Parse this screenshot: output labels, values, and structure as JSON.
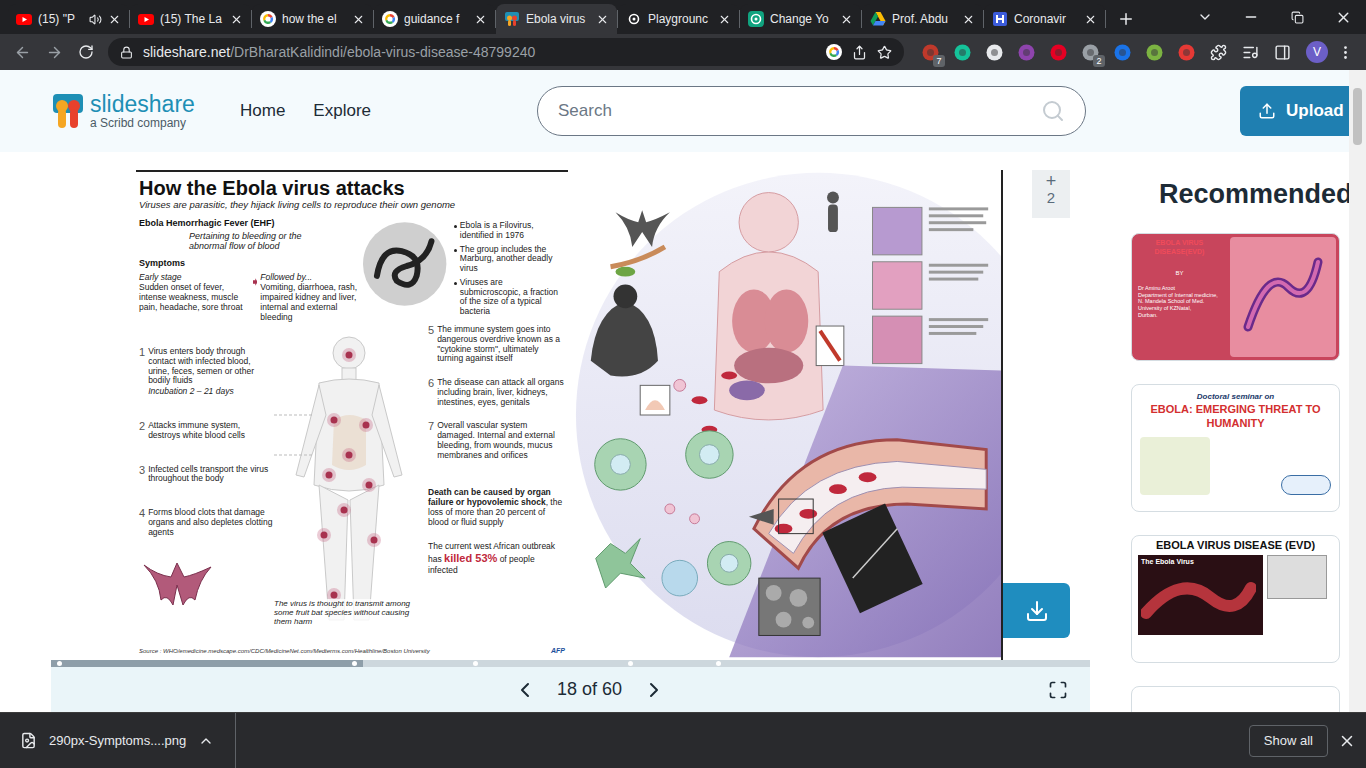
{
  "browser": {
    "tabs": [
      {
        "label": "(15) \"P",
        "kind": "youtube",
        "audio": true,
        "selected": false
      },
      {
        "label": "(15) The La",
        "kind": "youtube",
        "audio": false,
        "selected": false
      },
      {
        "label": "how the el",
        "kind": "google",
        "audio": false,
        "selected": false
      },
      {
        "label": "guidance f",
        "kind": "google",
        "audio": false,
        "selected": false
      },
      {
        "label": "Ebola virus",
        "kind": "slideshare",
        "audio": false,
        "selected": true
      },
      {
        "label": "Playgrounc",
        "kind": "openai-dark",
        "audio": false,
        "selected": false
      },
      {
        "label": "Change Yo",
        "kind": "openai",
        "audio": false,
        "selected": false
      },
      {
        "label": "Prof. Abdu",
        "kind": "drive",
        "audio": false,
        "selected": false
      },
      {
        "label": "Coronavir",
        "kind": "doc",
        "audio": false,
        "selected": false
      }
    ],
    "address": {
      "host": "slideshare.net",
      "path": "/DrBharatKalidindi/ebola-virus-disease-48799240"
    },
    "extensions": [
      {
        "kind": "dot",
        "color": "#c0392b",
        "badge": "7"
      },
      {
        "kind": "dot",
        "color": "#15c39a"
      },
      {
        "kind": "dot",
        "color": "#e8eaed"
      },
      {
        "kind": "dot",
        "color": "#8e44ad"
      },
      {
        "kind": "dot",
        "color": "#e60023"
      },
      {
        "kind": "dot",
        "color": "#9aa0a6",
        "badge": "2"
      },
      {
        "kind": "dot",
        "color": "#1a73e8"
      },
      {
        "kind": "dot",
        "color": "#7cb342"
      },
      {
        "kind": "dot",
        "color": "#e53935"
      },
      {
        "kind": "puzzle"
      },
      {
        "kind": "media"
      },
      {
        "kind": "panel"
      }
    ],
    "profile": "V"
  },
  "header": {
    "logo": {
      "name": "slideshare",
      "tagline": "a Scribd company"
    },
    "nav": [
      "Home",
      "Explore"
    ],
    "search": {
      "placeholder": "Search"
    },
    "upload": "Upload"
  },
  "slide": {
    "title": "How the Ebola virus attacks",
    "subtitle": "Viruses are parasitic, they hijack living cells to reproduce their own genome",
    "disease": "Ebola Hemorrhagic Fever (EHF)",
    "definition": "Pertaining to bleeding or the abnormal flow of blood",
    "symptoms_heading": "Symptoms",
    "symptoms": [
      {
        "label": "Early stage",
        "text": "Sudden onset of fever, intense weakness, muscle pain, headache, sore throat"
      },
      {
        "label": "Followed by...",
        "text": "Vomiting, diarrhoea, rash, impaired kidney and liver, internal and external bleeding"
      }
    ],
    "facts": [
      "Ebola is a Filovirus, identified in 1976",
      "The group includes the Marburg, another deadly virus",
      "Viruses are submicroscopic, a fraction of the size of a typical bacteria"
    ],
    "steps": [
      {
        "number": "1",
        "text": "Virus enters body through contact with infected blood, urine, feces, semen or other bodily fluids",
        "note": "Incubation 2 – 21 days",
        "side": "left"
      },
      {
        "number": "2",
        "text": "Attacks immune system, destroys white blood cells",
        "side": "left"
      },
      {
        "number": "3",
        "text": "Infected cells transport the virus throughout the body",
        "side": "left"
      },
      {
        "number": "4",
        "text": "Forms blood clots that damage organs and also depletes clotting agents",
        "side": "left"
      },
      {
        "number": "5",
        "text": "The immune system goes into dangerous overdrive known as a \"cytokine storm\", ultimately turning against itself",
        "side": "right"
      },
      {
        "number": "6",
        "text": "The disease can attack all organs including brain, liver, kidneys, intestines, eyes, genitals",
        "side": "right"
      },
      {
        "number": "7",
        "text": "Overall vascular system damaged. Internal and external bleeding, from wounds, mucus membranes and orifices",
        "side": "right"
      }
    ],
    "bat_note": "The virus is thought to transmit among some fruit bat species without causing them harm",
    "death": {
      "bold": "Death can be caused by organ failure or hypovolemic shock",
      "rest": ", the loss of more than 20 percent of blood or fluid supply"
    },
    "outbreak": {
      "before": "The current west African outbreak has ",
      "highlight": "killed 53%",
      "after": " of people infected"
    },
    "source": "Source : WHO/emedicine.medscape.com/CDC/MedicineNet.com/Medterms.com/Healthline/Boston University",
    "credit": "AFP"
  },
  "viewer": {
    "bookmark": {
      "plus": "+",
      "count": "2"
    },
    "page": "18 of 60",
    "progress": {
      "level": 0.3,
      "markers": [
        0.006,
        0.29,
        0.406,
        0.555,
        0.64
      ]
    }
  },
  "sidebar": {
    "title": "Recommended",
    "cards": [
      {
        "kind": "red",
        "title": "EBOLA VIRUS DISEASE(EVD)",
        "by": "BY",
        "author": [
          "Dr Aminu Aroot",
          "Department of Internal medicine,",
          "N. Mandela School of Med.",
          "University of KZNatal,",
          "Durban."
        ]
      },
      {
        "kind": "seminar",
        "kicker": "Doctoral seminar on",
        "title": "EBOLA: EMERGING THREAT TO HUMANITY"
      },
      {
        "kind": "dark",
        "title": "EBOLA VIRUS DISEASE (EVD)",
        "caption": "The Ebola Virus"
      }
    ]
  },
  "downloads": {
    "file": "290px-Symptoms....png",
    "show_all": "Show all"
  }
}
